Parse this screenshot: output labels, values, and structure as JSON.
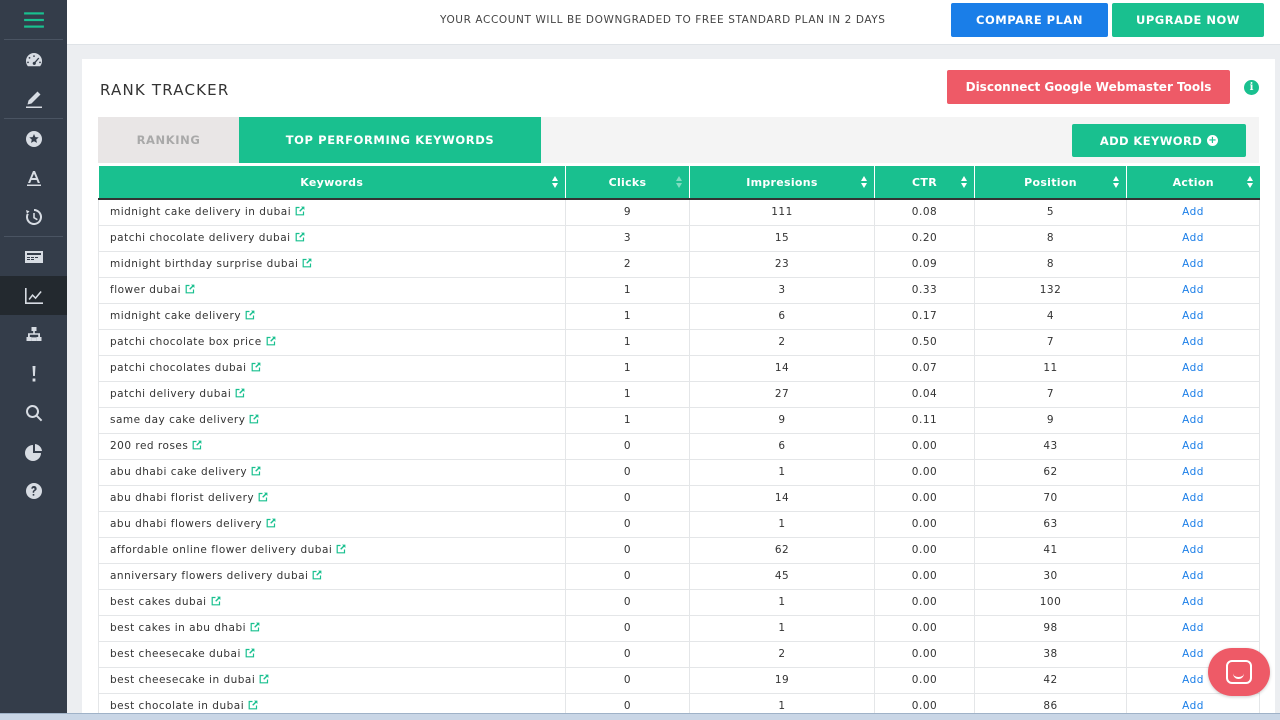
{
  "colors": {
    "accent": "#19c08f",
    "primary": "#1a7ee8",
    "danger": "#ee5a67",
    "sidebar": "#343d4a"
  },
  "sidebar": {
    "items": [
      {
        "icon": "menu-icon"
      },
      {
        "icon": "dashboard-icon"
      },
      {
        "icon": "pencil-icon"
      },
      {
        "icon": "star-icon"
      },
      {
        "icon": "text-icon"
      },
      {
        "icon": "history-icon"
      },
      {
        "icon": "card-icon"
      },
      {
        "icon": "line-chart-icon",
        "active": true
      },
      {
        "icon": "sitemap-icon"
      },
      {
        "icon": "exclamation-icon"
      },
      {
        "icon": "search-icon"
      },
      {
        "icon": "pie-chart-icon"
      },
      {
        "icon": "help-icon"
      }
    ]
  },
  "topbar": {
    "notice": "YOUR ACCOUNT WILL BE DOWNGRADED TO FREE STANDARD PLAN IN 2 DAYS",
    "compare_label": "COMPARE PLAN",
    "upgrade_label": "UPGRADE NOW"
  },
  "page": {
    "title": "RANK TRACKER",
    "disconnect_label": "Disconnect Google Webmaster Tools",
    "info_glyph": "i"
  },
  "tabs": {
    "ranking": "RANKING",
    "top": "TOP PERFORMING KEYWORDS",
    "add_keyword": "ADD KEYWORD",
    "add_glyph": "+"
  },
  "table": {
    "headers": [
      "Keywords",
      "Clicks",
      "Impresions",
      "CTR",
      "Position",
      "Action"
    ],
    "rows": [
      [
        "midnight cake delivery in dubai",
        "9",
        "111",
        "0.08",
        "5",
        "Add"
      ],
      [
        "patchi chocolate delivery dubai",
        "3",
        "15",
        "0.20",
        "8",
        "Add"
      ],
      [
        "midnight birthday surprise dubai",
        "2",
        "23",
        "0.09",
        "8",
        "Add"
      ],
      [
        "flower dubai",
        "1",
        "3",
        "0.33",
        "132",
        "Add"
      ],
      [
        "midnight cake delivery",
        "1",
        "6",
        "0.17",
        "4",
        "Add"
      ],
      [
        "patchi chocolate box price",
        "1",
        "2",
        "0.50",
        "7",
        "Add"
      ],
      [
        "patchi chocolates dubai",
        "1",
        "14",
        "0.07",
        "11",
        "Add"
      ],
      [
        "patchi delivery dubai",
        "1",
        "27",
        "0.04",
        "7",
        "Add"
      ],
      [
        "same day cake delivery",
        "1",
        "9",
        "0.11",
        "9",
        "Add"
      ],
      [
        "200 red roses",
        "0",
        "6",
        "0.00",
        "43",
        "Add"
      ],
      [
        "abu dhabi cake delivery",
        "0",
        "1",
        "0.00",
        "62",
        "Add"
      ],
      [
        "abu dhabi florist delivery",
        "0",
        "14",
        "0.00",
        "70",
        "Add"
      ],
      [
        "abu dhabi flowers delivery",
        "0",
        "1",
        "0.00",
        "63",
        "Add"
      ],
      [
        "affordable online flower delivery dubai",
        "0",
        "62",
        "0.00",
        "41",
        "Add"
      ],
      [
        "anniversary flowers delivery dubai",
        "0",
        "45",
        "0.00",
        "30",
        "Add"
      ],
      [
        "best cakes dubai",
        "0",
        "1",
        "0.00",
        "100",
        "Add"
      ],
      [
        "best cakes in abu dhabi",
        "0",
        "1",
        "0.00",
        "98",
        "Add"
      ],
      [
        "best cheesecake dubai",
        "0",
        "2",
        "0.00",
        "38",
        "Add"
      ],
      [
        "best cheesecake in dubai",
        "0",
        "19",
        "0.00",
        "42",
        "Add"
      ],
      [
        "best chocolate in dubai",
        "0",
        "1",
        "0.00",
        "86",
        "Add"
      ]
    ]
  },
  "chat": {
    "icon": "chat-icon"
  }
}
